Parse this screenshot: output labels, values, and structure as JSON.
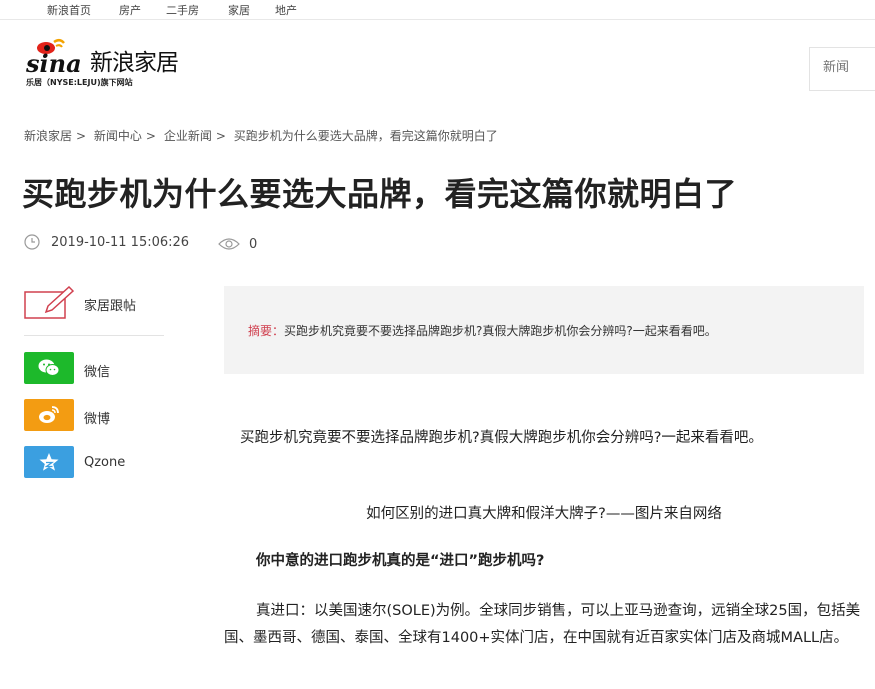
{
  "topnav": [
    "新浪首页",
    "房产",
    "二手房",
    "家居",
    "地产"
  ],
  "logo": {
    "brand": "sina",
    "name": "新浪家居",
    "sub": "乐居（NYSE:LEJU)旗下网站"
  },
  "search": {
    "placeholder": "新闻"
  },
  "breadcrumb": [
    {
      "label": "新浪家居",
      "sep": ">"
    },
    {
      "label": "新闻中心",
      "sep": ">"
    },
    {
      "label": "企业新闻",
      "sep": ">"
    },
    {
      "label": "买跑步机为什么要选大品牌，看完这篇你就明白了",
      "sep": ""
    }
  ],
  "article": {
    "title": "买跑步机为什么要选大品牌，看完这篇你就明白了",
    "date": "2019-10-11 15:06:26",
    "views": "0",
    "summary_label": "摘要：",
    "summary": "买跑步机究竟要不要选择品牌跑步机?真假大牌跑步机你会分辨吗?一起来看看吧。",
    "p1": "买跑步机究竟要不要选择品牌跑步机?真假大牌跑步机你会分辨吗?一起来看看吧。",
    "caption": "如何区别的进口真大牌和假洋大牌子?——图片来自网络",
    "subheading": "你中意的进口跑步机真的是“进口”跑步机吗?",
    "p2": "真进口：以美国速尔(SOLE)为例。全球同步销售，可以上亚马逊查询，远销全球25国，包括美国、墨西哥、德国、泰国、全球有1400+实体门店，在中国就有近百家实体门店及商城MALL店。"
  },
  "share": {
    "comment": "家居跟帖",
    "wechat": "微信",
    "weibo": "微博",
    "qzone": "Qzone"
  },
  "colors": {
    "wechat": "#1db92b",
    "weibo": "#f39c12",
    "qzone": "#3b9fe0",
    "summary_label": "#d0404f",
    "logo_red": "#e2231a"
  }
}
